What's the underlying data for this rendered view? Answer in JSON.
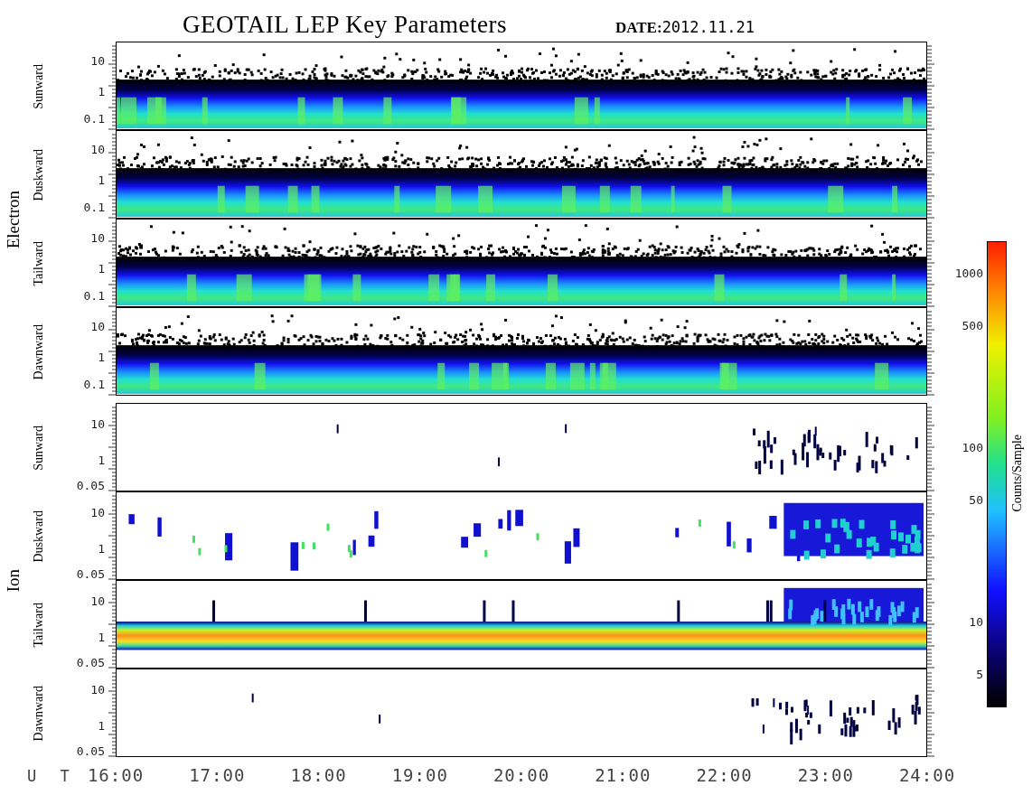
{
  "title": "GEOTAIL LEP Key Parameters",
  "date": "**DATE:**2012.11.21",
  "groups": [
    {
      "label": "Electron",
      "panels": [
        {
          "label": "Sunward",
          "kind": "dense",
          "yticks": [
            "10",
            "1",
            "0.1"
          ]
        },
        {
          "label": "Duskward",
          "kind": "dense",
          "yticks": [
            "10",
            "1",
            "0.1"
          ]
        },
        {
          "label": "Tailward",
          "kind": "dense",
          "yticks": [
            "10",
            "1",
            "0.1"
          ]
        },
        {
          "label": "Dawnward",
          "kind": "dense",
          "yticks": [
            "10",
            "1",
            "0.1"
          ]
        }
      ]
    },
    {
      "label": "Ion",
      "panels": [
        {
          "label": "Sunward",
          "kind": "sparse",
          "yticks": [
            "10",
            "1",
            "0.05"
          ]
        },
        {
          "label": "Duskward",
          "kind": "patchy",
          "yticks": [
            "10",
            "1",
            "0.05"
          ]
        },
        {
          "label": "Tailward",
          "kind": "band",
          "yticks": [
            "10",
            "1",
            "0.05"
          ]
        },
        {
          "label": "Dawnward",
          "kind": "sparse",
          "yticks": [
            "10",
            "1",
            "0.05"
          ]
        }
      ]
    }
  ],
  "colorbar": {
    "title": "Counts/Sample",
    "ticks": [
      "1000",
      "500",
      "100",
      "50",
      "10",
      "5"
    ]
  },
  "xaxis": {
    "title": "U T",
    "ticks": [
      "16:00",
      "17:00",
      "18:00",
      "19:00",
      "20:00",
      "21:00",
      "22:00",
      "23:00",
      "24:00"
    ]
  }
}
